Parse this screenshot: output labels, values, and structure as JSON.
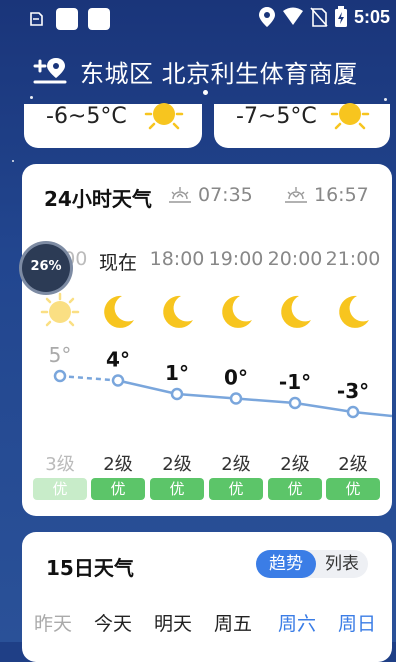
{
  "status_bar": {
    "time": "5:05"
  },
  "header": {
    "location": "东城区 北京利生体育商厦"
  },
  "mini_cards": [
    {
      "temp": "-6~5°C"
    },
    {
      "temp": "-7~5°C"
    }
  ],
  "hourly": {
    "title": "24小时天气",
    "sunrise": "07:35",
    "sunset": "16:57",
    "progress_label": "26%",
    "hours": [
      "17:00",
      "现在",
      "18:00",
      "19:00",
      "20:00",
      "21:00"
    ],
    "temps": [
      "5°",
      "4°",
      "1°",
      "0°",
      "-1°",
      "-3°"
    ],
    "temp_values": [
      5,
      4,
      1,
      0,
      -1,
      -3
    ],
    "aqi_levels": [
      "3级",
      "2级",
      "2级",
      "2级",
      "2级",
      "2级"
    ],
    "aqi_quality": [
      "优",
      "优",
      "优",
      "优",
      "优",
      "优"
    ],
    "colors": {
      "line": "#7aa6dc",
      "good": "#5cc569",
      "sun": "#f7c51f"
    }
  },
  "daily": {
    "title": "15日天气",
    "toggle_active": "趋势",
    "toggle_inactive": "列表",
    "days": [
      "昨天",
      "今天",
      "明天",
      "周五",
      "周六",
      "周日"
    ]
  }
}
